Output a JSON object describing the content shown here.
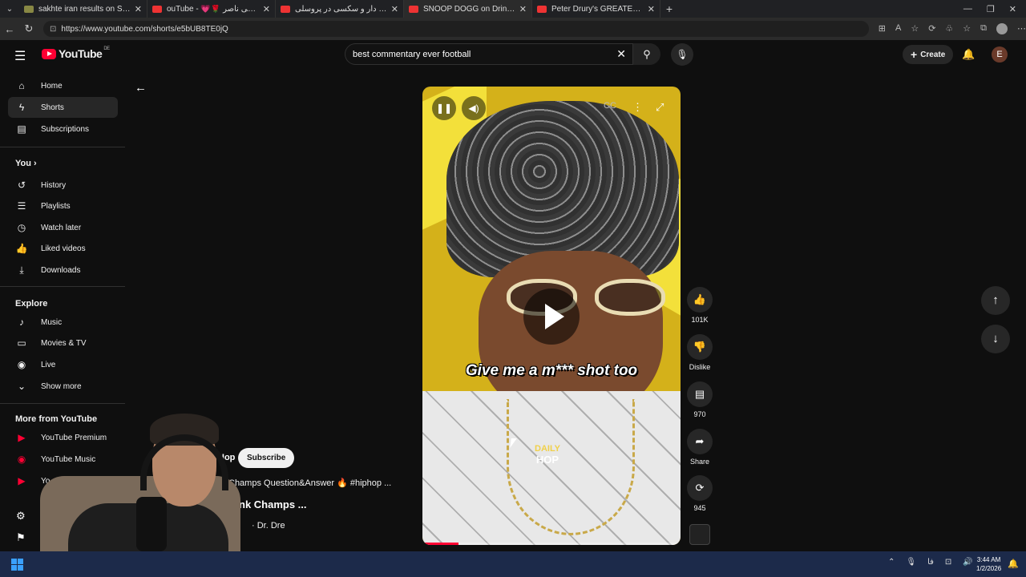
{
  "browser": {
    "tabs": [
      {
        "title": "sakhte iran results on SoundCloud",
        "favicon": "soundcloud-icon",
        "active": false
      },
      {
        "title": "ouTube - 💗🌹 بوق زدن حاجی ناصر",
        "favicon": "youtube-icon",
        "active": false
      },
      {
        "title": "دوبله خنده دار و سکسی در پروسلی",
        "favicon": "youtube-icon",
        "active": false
      },
      {
        "title": "SNOOP DOGG on Drink Champs",
        "favicon": "youtube-icon",
        "active": true
      },
      {
        "title": "Peter Drury's GREATEST Commentary",
        "favicon": "youtube-icon",
        "active": false
      }
    ],
    "url": "https://www.youtube.com/shorts/e5bUB8TE0jQ"
  },
  "header": {
    "logo_text": "YouTube",
    "country": "DE",
    "search_value": "best commentary ever football",
    "create_label": "Create",
    "avatar_letter": "E"
  },
  "sidebar": {
    "main": [
      {
        "label": "Home",
        "icon": "home-icon"
      },
      {
        "label": "Shorts",
        "icon": "shorts-icon",
        "active": true
      },
      {
        "label": "Subscriptions",
        "icon": "subscriptions-icon"
      }
    ],
    "you_heading": "You",
    "you": [
      {
        "label": "History",
        "icon": "history-icon"
      },
      {
        "label": "Playlists",
        "icon": "playlists-icon"
      },
      {
        "label": "Watch later",
        "icon": "watch-later-icon"
      },
      {
        "label": "Liked videos",
        "icon": "liked-icon"
      },
      {
        "label": "Downloads",
        "icon": "downloads-icon"
      }
    ],
    "explore_heading": "Explore",
    "explore": [
      {
        "label": "Music",
        "icon": "music-icon"
      },
      {
        "label": "Movies & TV",
        "icon": "movies-icon"
      },
      {
        "label": "Live",
        "icon": "live-icon"
      },
      {
        "label": "Show more",
        "icon": "chevron-down-icon"
      }
    ],
    "more_heading": "More from YouTube",
    "more": [
      {
        "label": "YouTube Premium",
        "icon": "youtube-premium-icon"
      },
      {
        "label": "YouTube Music",
        "icon": "youtube-music-icon"
      },
      {
        "label": "Yo",
        "icon": "youtube-kids-icon"
      }
    ]
  },
  "short": {
    "caption": "Give me a m*** shot too",
    "watermark_line1": "DAILY",
    "watermark_line2": "HOP",
    "progress": 0.14,
    "channel": "Hop",
    "subscribe_label": "Subscribe",
    "description": "Champs Question&Answer 🔥 #hiphop ...",
    "title": "nk Champs ...",
    "music": "· Dr. Dre"
  },
  "actions": {
    "likes": "101K",
    "dislike_label": "Dislike",
    "comments": "970",
    "share_label": "Share",
    "remix": "945"
  },
  "taskbar": {
    "time": "3:44 AM",
    "date": "1/2/2026",
    "lang": "فا"
  }
}
